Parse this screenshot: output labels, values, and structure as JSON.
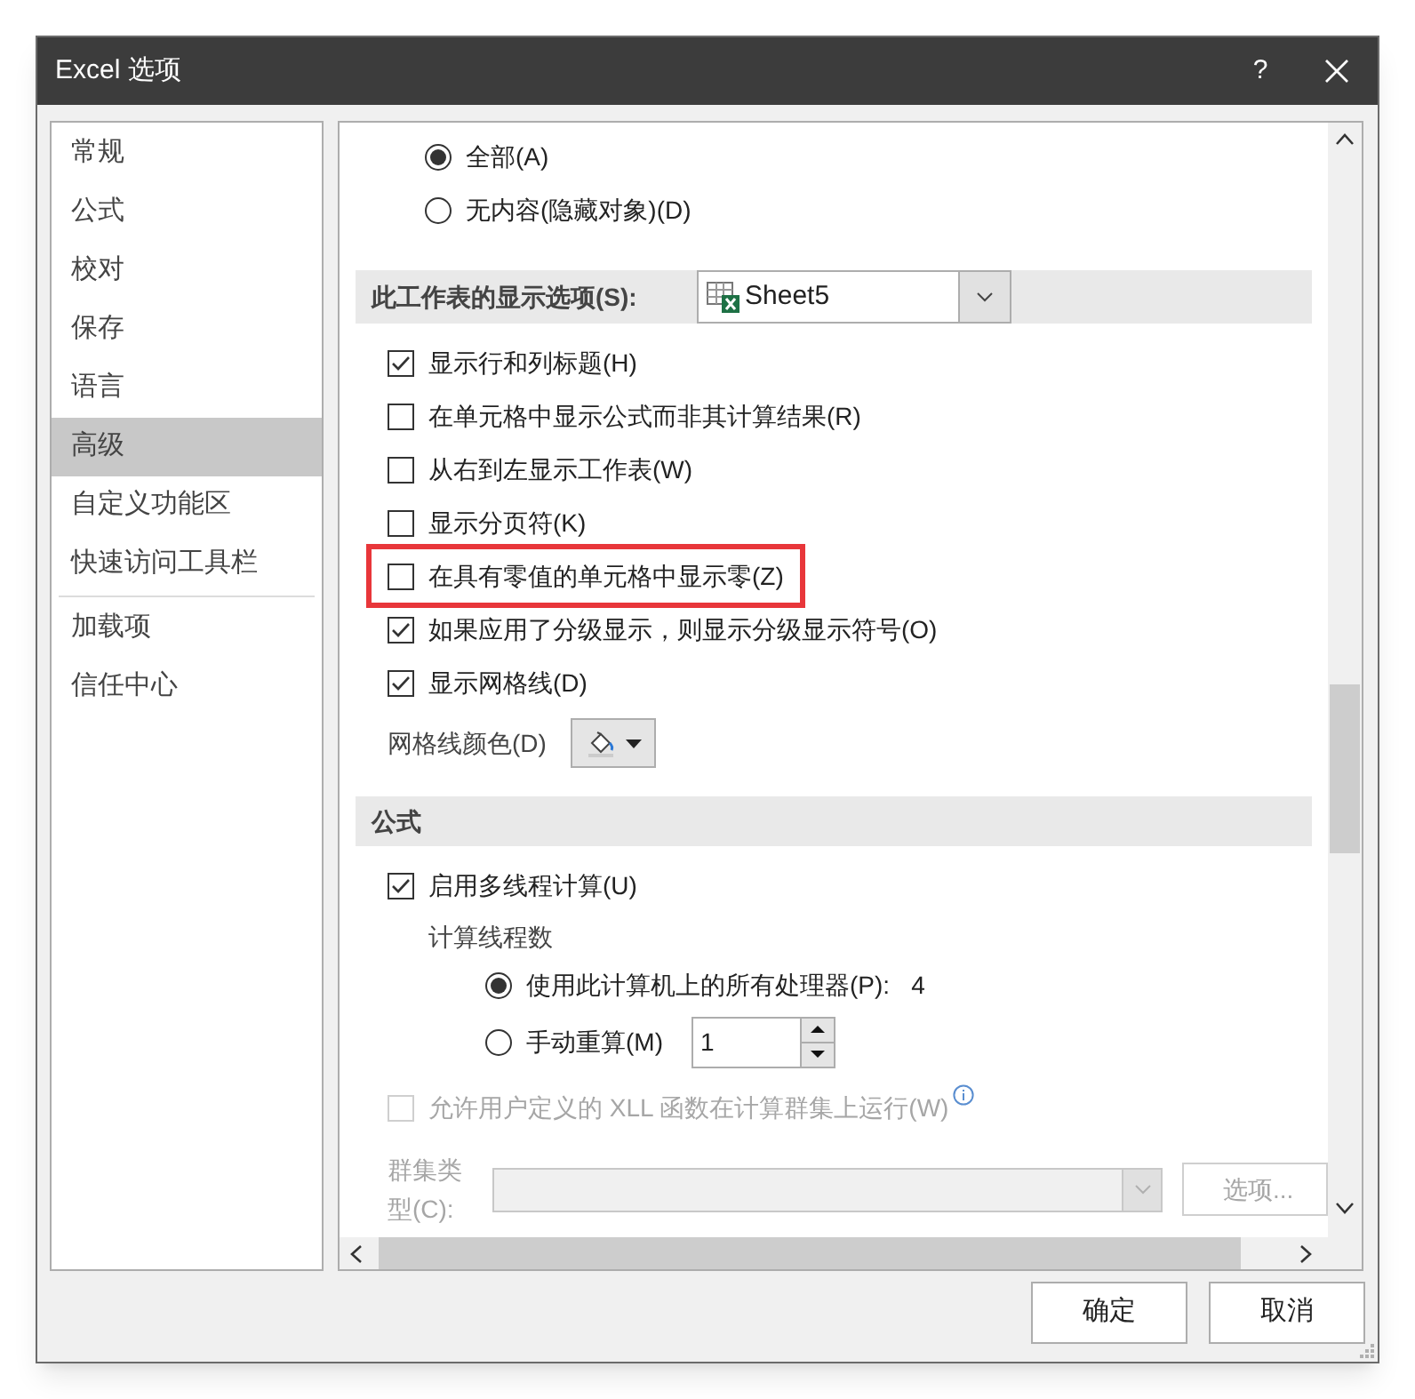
{
  "window": {
    "title": "Excel 选项",
    "help": "?"
  },
  "sidebar": {
    "groups": [
      [
        {
          "label": "常规",
          "selected": false
        },
        {
          "label": "公式",
          "selected": false
        },
        {
          "label": "校对",
          "selected": false
        },
        {
          "label": "保存",
          "selected": false
        },
        {
          "label": "语言",
          "selected": false
        },
        {
          "label": "高级",
          "selected": true
        },
        {
          "label": "自定义功能区",
          "selected": false
        },
        {
          "label": "快速访问工具栏",
          "selected": false
        }
      ],
      [
        {
          "label": "加载项",
          "selected": false
        },
        {
          "label": "信任中心",
          "selected": false
        }
      ]
    ]
  },
  "object_radios": [
    {
      "label": "全部(A)",
      "selected": true
    },
    {
      "label": "无内容(隐藏对象)(D)",
      "selected": false
    }
  ],
  "sheet_section": {
    "label": "此工作表的显示选项(S):",
    "sheet": "Sheet5"
  },
  "sheet_checkboxes": [
    {
      "label": "显示行和列标题(H)",
      "checked": true,
      "highlighted": false
    },
    {
      "label": "在单元格中显示公式而非其计算结果(R)",
      "checked": false,
      "highlighted": false
    },
    {
      "label": "从右到左显示工作表(W)",
      "checked": false,
      "highlighted": false
    },
    {
      "label": "显示分页符(K)",
      "checked": false,
      "highlighted": false
    },
    {
      "label": "在具有零值的单元格中显示零(Z)",
      "checked": false,
      "highlighted": true
    },
    {
      "label": "如果应用了分级显示，则显示分级显示符号(O)",
      "checked": true,
      "highlighted": false
    },
    {
      "label": "显示网格线(D)",
      "checked": true,
      "highlighted": false
    }
  ],
  "gridline_color": {
    "label": "网格线颜色(D)"
  },
  "formula_section": {
    "label": "公式",
    "multithread": {
      "label": "启用多线程计算(U)",
      "checked": true
    },
    "threads_label": "计算线程数",
    "thread_options": [
      {
        "label": "使用此计算机上的所有处理器(P):",
        "selected": true,
        "value": "4"
      },
      {
        "label": "手动重算(M)",
        "selected": false,
        "spin_value": "1"
      }
    ],
    "xll": {
      "label": "允许用户定义的 XLL 函数在计算群集上运行(W)",
      "checked": false,
      "disabled": true
    },
    "cluster": {
      "label": "群集类型(C):",
      "button": "选项...",
      "disabled": true
    }
  },
  "buttons": [
    {
      "label": "确定"
    },
    {
      "label": "取消"
    }
  ]
}
